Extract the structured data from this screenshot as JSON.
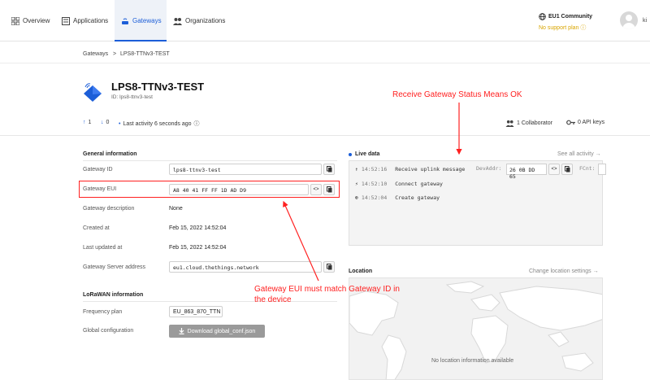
{
  "nav": {
    "items": [
      {
        "label": "Overview",
        "icon": "grid-icon"
      },
      {
        "label": "Applications",
        "icon": "list-icon"
      },
      {
        "label": "Gateways",
        "icon": "gateway-icon"
      },
      {
        "label": "Organizations",
        "icon": "people-icon"
      }
    ],
    "community": "EU1 Community",
    "support": "No support plan",
    "user": "ki"
  },
  "breadcrumb": {
    "parent": "Gateways",
    "separator": ">",
    "current": "LPS8-TTNv3-TEST"
  },
  "header": {
    "title": "LPS8-TTNv3-TEST",
    "id_line": "ID: lps8-ttnv3-test",
    "up_count": "1",
    "down_count": "0",
    "last_activity": "Last activity 6 seconds ago",
    "collaborators": "1 Collaborator",
    "api_keys": "0 API keys"
  },
  "general": {
    "title": "General information",
    "gateway_id_label": "Gateway ID",
    "gateway_id": "lps8-ttnv3-test",
    "gateway_eui_label": "Gateway EUI",
    "gateway_eui": "A8 40 41 FF FF 1D AD D9",
    "description_label": "Gateway description",
    "description": "None",
    "created_label": "Created at",
    "created": "Feb 15, 2022 14:52:04",
    "updated_label": "Last updated at",
    "updated": "Feb 15, 2022 14:52:04",
    "server_label": "Gateway Server address",
    "server": "eu1.cloud.thethings.network"
  },
  "lorawan": {
    "title": "LoRaWAN information",
    "freq_label": "Frequency plan",
    "freq": "EU_863_870_TTN",
    "global_label": "Global configuration",
    "download": "Download global_conf.json"
  },
  "live": {
    "title": "Live data",
    "see_all": "See all activity →",
    "events": [
      {
        "time": "14:52:16",
        "text": "Receive uplink message",
        "icon": "arrow-up-icon"
      },
      {
        "time": "14:52:10",
        "text": "Connect gateway",
        "icon": "plug-icon"
      },
      {
        "time": "14:52:04",
        "text": "Create gateway",
        "icon": "plus-circle-icon"
      }
    ],
    "devaddr_label": "DevAddr:",
    "devaddr": "26 0B DD 65",
    "fcnt_label": "FCnt:"
  },
  "location": {
    "title": "Location",
    "change": "Change location settings →",
    "empty": "No location information available"
  },
  "annotations": {
    "status": "Receive Gateway Status Means OK",
    "eui_note_1": "Gateway EUI must match Gateway ID in",
    "eui_note_2": "the device"
  },
  "colors": {
    "accent": "#1c5ed8",
    "annotation": "#ff2020",
    "warning": "#d9a500"
  }
}
